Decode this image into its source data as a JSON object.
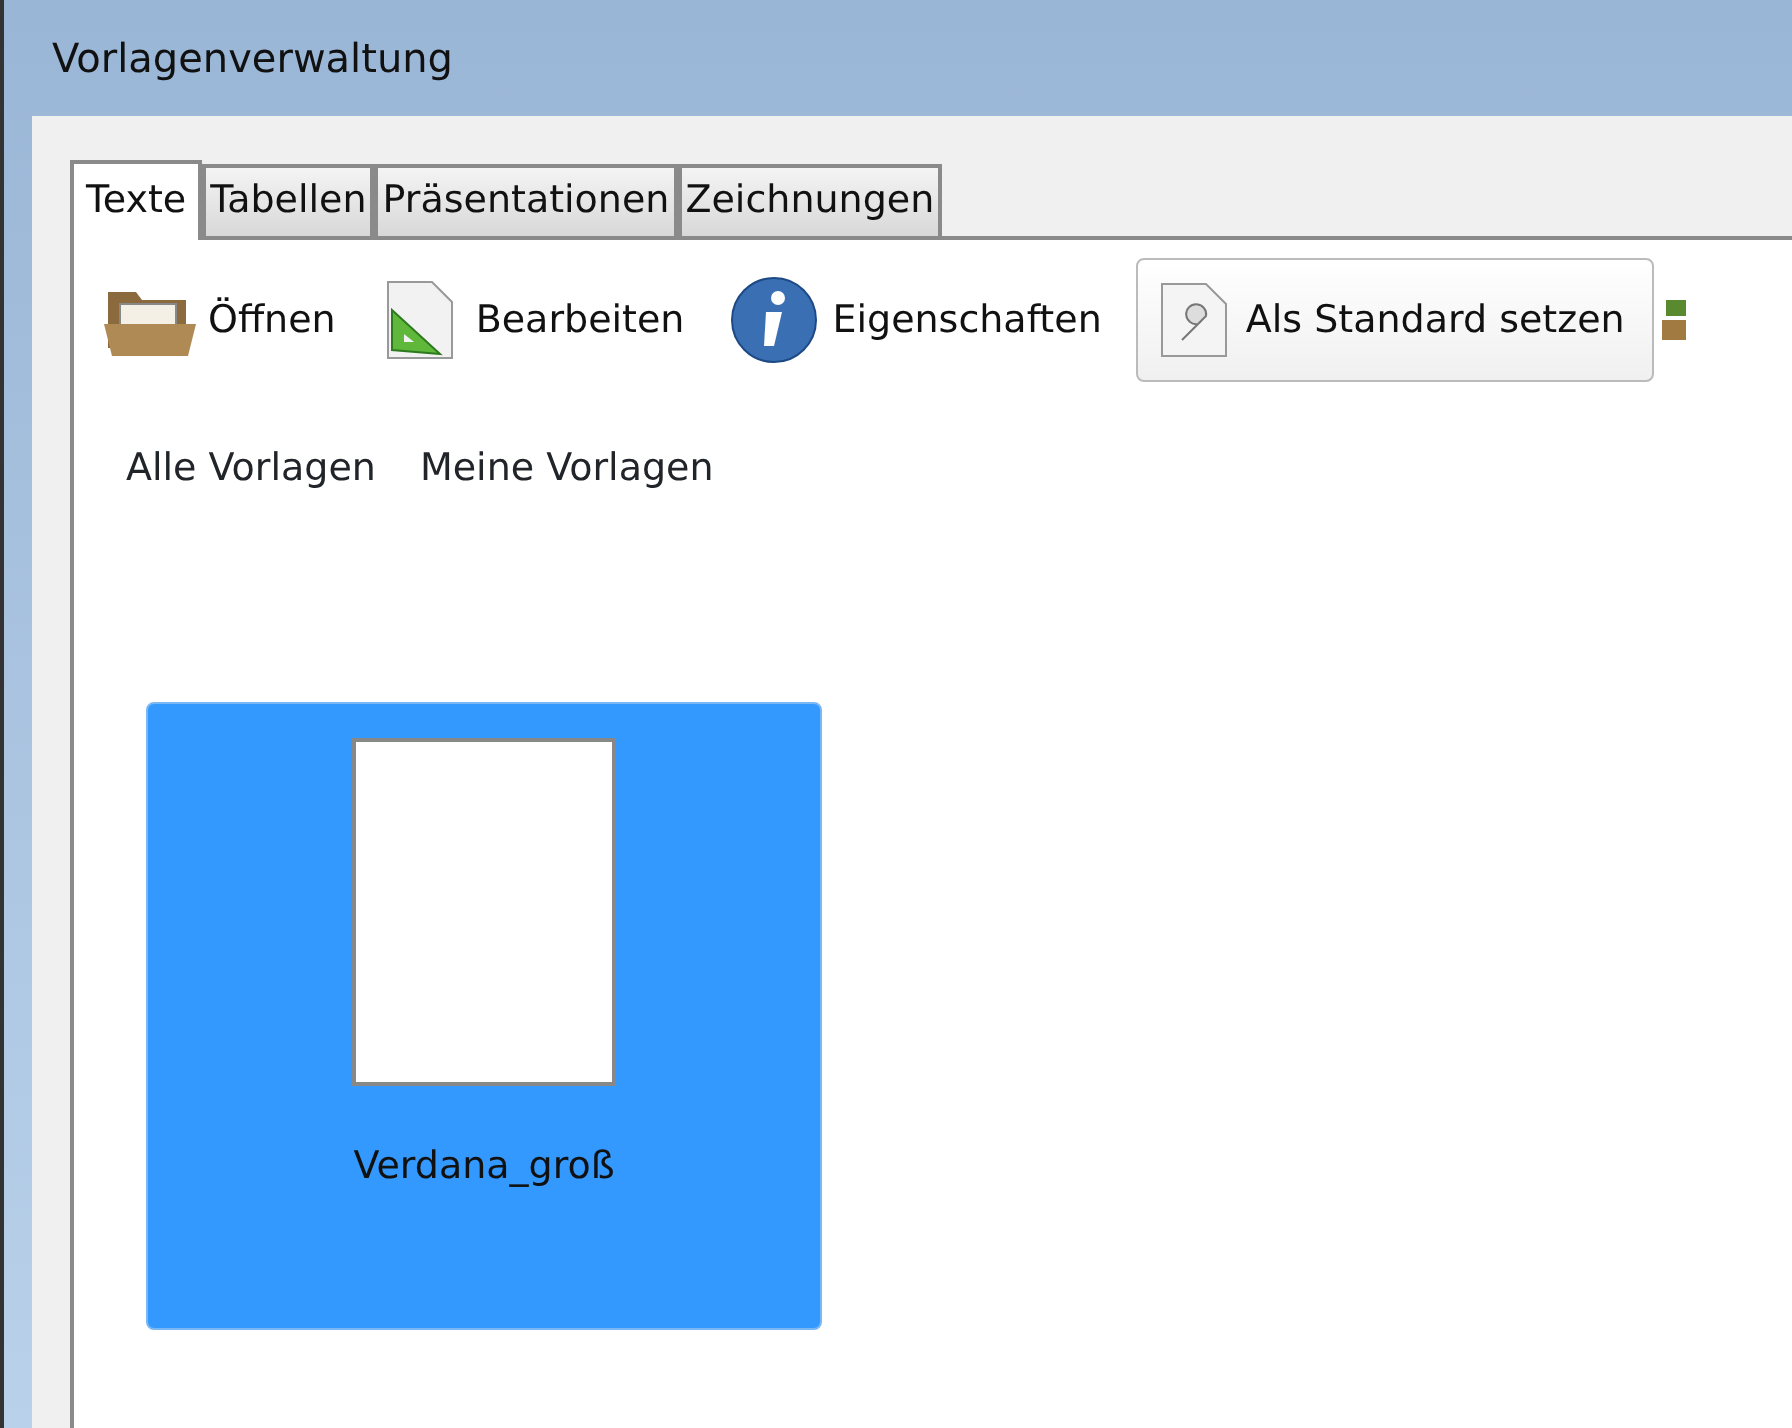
{
  "window": {
    "title": "Vorlagenverwaltung"
  },
  "tabs": [
    {
      "label": "Texte",
      "selected": true
    },
    {
      "label": "Tabellen",
      "selected": false
    },
    {
      "label": "Präsentationen",
      "selected": false
    },
    {
      "label": "Zeichnungen",
      "selected": false
    }
  ],
  "toolbar": [
    {
      "kind": "folder",
      "label": "Öffnen",
      "highlighted": false
    },
    {
      "kind": "edit",
      "label": "Bearbeiten",
      "highlighted": false
    },
    {
      "kind": "info",
      "label": "Eigenschaften",
      "highlighted": false
    },
    {
      "kind": "default",
      "label": "Als Standard setzen",
      "highlighted": true
    },
    {
      "kind": "partial"
    }
  ],
  "filters": [
    {
      "label": "Alle Vorlagen"
    },
    {
      "label": "Meine Vorlagen"
    }
  ],
  "templates": [
    {
      "name": "Verdana_groß",
      "selected": true
    }
  ]
}
